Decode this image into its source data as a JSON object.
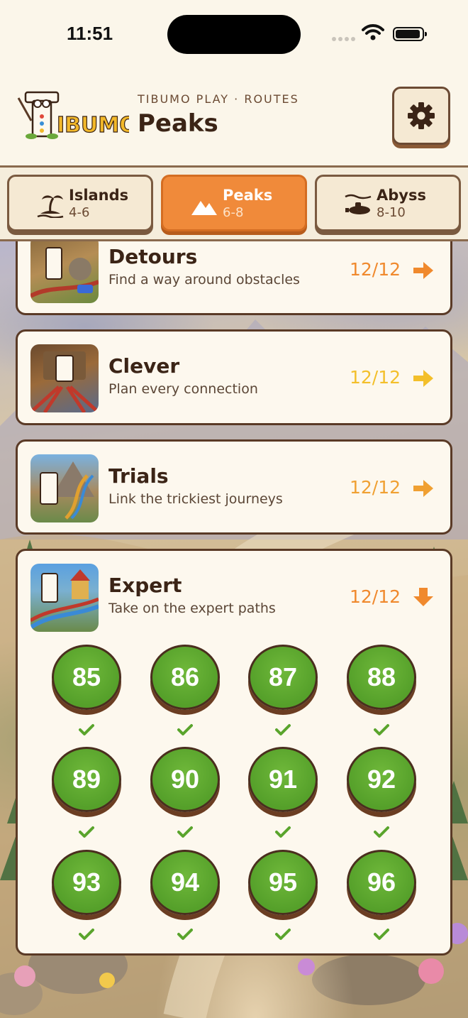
{
  "status_bar": {
    "time": "11:51"
  },
  "header": {
    "logo_text": "IBUMO",
    "subtitle": "TIBUMO PLAY · ROUTES",
    "title": "Peaks",
    "settings_icon": "gear-icon"
  },
  "tabs": [
    {
      "name": "Islands",
      "range": "4-6",
      "icon": "island-palm-icon",
      "active": false
    },
    {
      "name": "Peaks",
      "range": "6-8",
      "icon": "mountain-icon",
      "active": true
    },
    {
      "name": "Abyss",
      "range": "8-10",
      "icon": "submarine-icon",
      "active": false
    }
  ],
  "levels_sets": [
    {
      "title": "Detours",
      "description": "Find a way around obstacles",
      "progress": "12/12",
      "arrow": "right",
      "color": "#f0892d"
    },
    {
      "title": "Clever",
      "description": "Plan every connection",
      "progress": "12/12",
      "arrow": "right",
      "color": "#f3bf2a"
    },
    {
      "title": "Trials",
      "description": "Link the trickiest journeys",
      "progress": "12/12",
      "arrow": "right",
      "color": "#f0a032"
    },
    {
      "title": "Expert",
      "description": "Take on the expert paths",
      "progress": "12/12",
      "arrow": "down",
      "color": "#f0892d"
    }
  ],
  "expert_levels": [
    "85",
    "86",
    "87",
    "88",
    "89",
    "90",
    "91",
    "92",
    "93",
    "94",
    "95",
    "96"
  ],
  "colors": {
    "accent_orange": "#f08a3a",
    "level_green": "#5aa42c",
    "check_green": "#5aa42c",
    "border_brown": "#5a3a26"
  }
}
